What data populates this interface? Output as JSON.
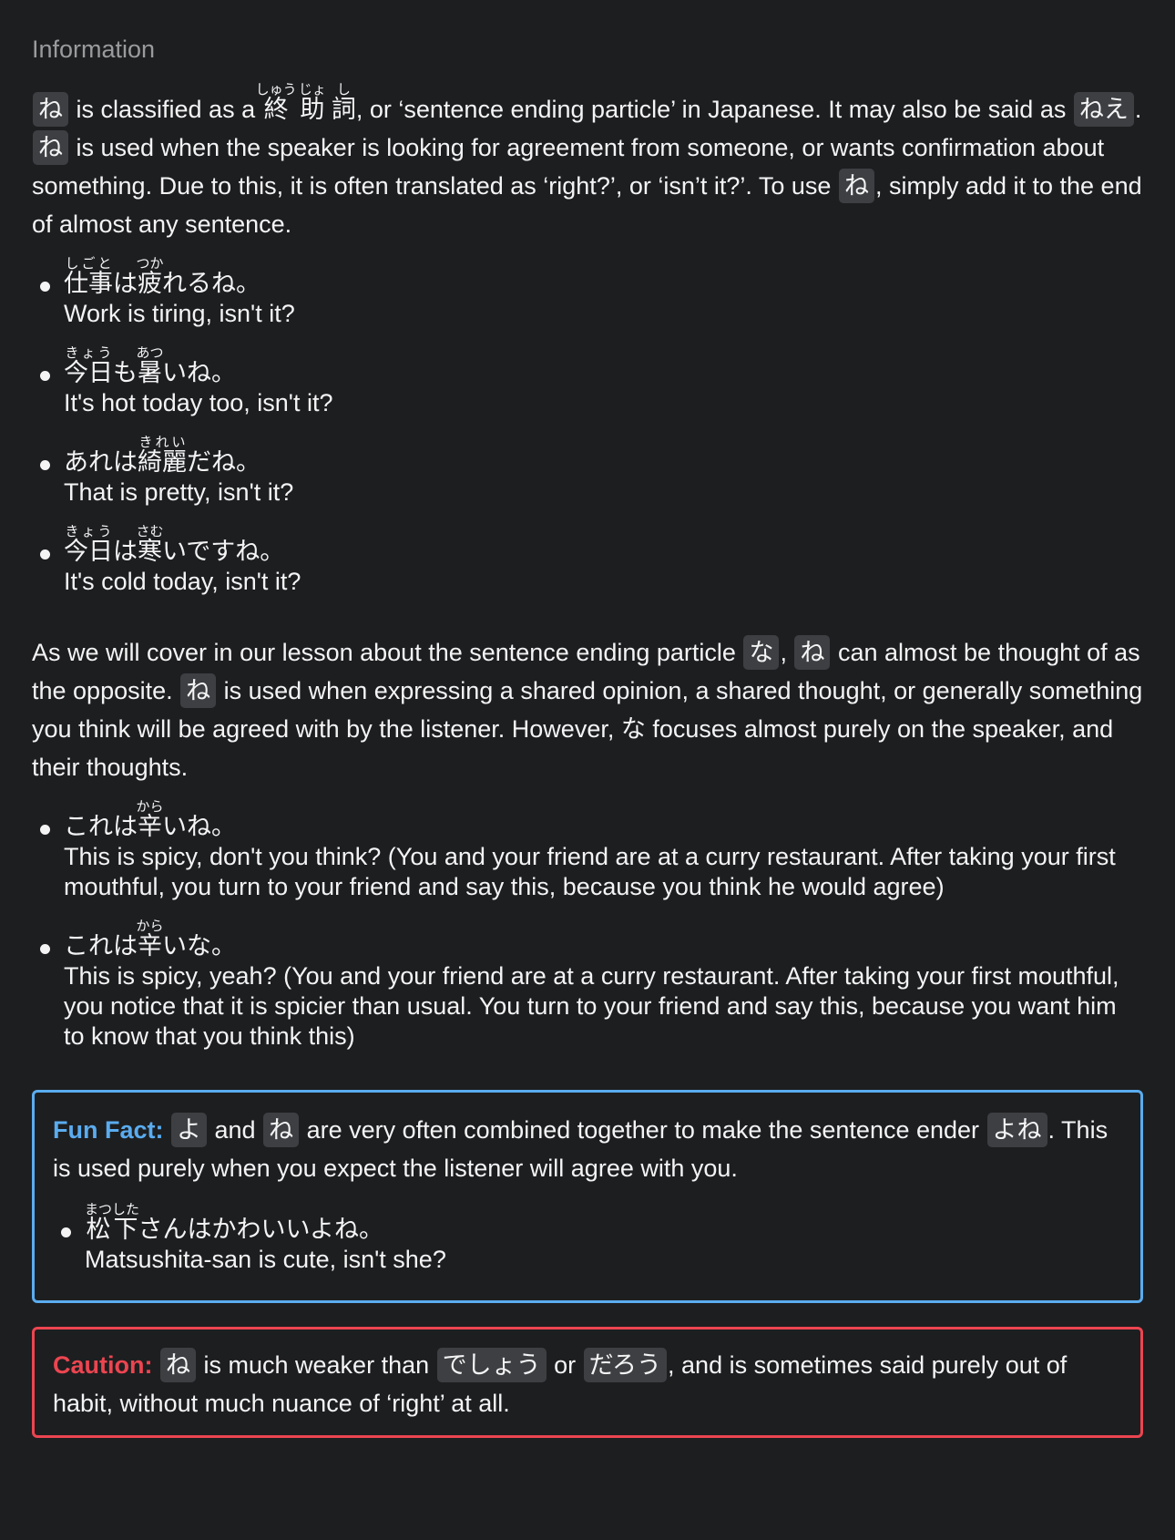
{
  "section_title": "Information",
  "intro": {
    "chip_ne": "ね",
    "t1": " is classified as a ",
    "kanji": [
      {
        "base": "終",
        "ruby": "しゅう"
      },
      {
        "base": "助",
        "ruby": "じょ"
      },
      {
        "base": "詞",
        "ruby": "し"
      }
    ],
    "t2": ", or ‘sentence ending particle’ in Japanese. It may also be said as ",
    "chip_nee": "ねえ",
    "t3": ". ",
    "t4": " is used when the speaker is looking for agreement from someone, or wants confirmation about something. Due to this, it is often translated as ‘right?’, or ‘isn’t it?’. To use ",
    "t5": ", simply add it to the end of almost any sentence."
  },
  "examples1": [
    {
      "segments": [
        {
          "base": "仕事",
          "ruby": "しごと"
        },
        {
          "text": "は"
        },
        {
          "base": "疲",
          "ruby": "つか"
        },
        {
          "text": "れるね。"
        }
      ],
      "english": "Work is tiring, isn't it?"
    },
    {
      "segments": [
        {
          "base": "今日",
          "ruby": "きょう"
        },
        {
          "text": "も"
        },
        {
          "base": "暑",
          "ruby": "あつ"
        },
        {
          "text": "いね。"
        }
      ],
      "english": "It's hot today too, isn't it?"
    },
    {
      "segments": [
        {
          "text": "あれは"
        },
        {
          "base": "綺麗",
          "ruby": "きれい"
        },
        {
          "text": "だね。"
        }
      ],
      "english": "That is pretty, isn't it?"
    },
    {
      "segments": [
        {
          "base": "今日",
          "ruby": "きょう"
        },
        {
          "text": "は"
        },
        {
          "base": "寒",
          "ruby": "さむ"
        },
        {
          "text": "いですね。"
        }
      ],
      "english": "It's cold today, isn't it?"
    }
  ],
  "comparison": {
    "t1": "As we will cover in our lesson about the sentence ending particle ",
    "chip_na": "な",
    "t2": ", ",
    "chip_ne": "ね",
    "t3": " can almost be thought of as the opposite. ",
    "t4": " is used when expressing a shared opinion, a shared thought, or generally something you think will be agreed with by the listener. However, な focuses almost purely on the speaker, and their thoughts."
  },
  "examples2": [
    {
      "segments": [
        {
          "text": "これは"
        },
        {
          "base": "辛",
          "ruby": "から"
        },
        {
          "text": "いね。"
        }
      ],
      "english": "This is spicy, don't you think? (You and your friend are at a curry restaurant. After taking your first mouthful, you turn to your friend and say this, because you think he would agree)"
    },
    {
      "segments": [
        {
          "text": "これは"
        },
        {
          "base": "辛",
          "ruby": "から"
        },
        {
          "text": "いな。"
        }
      ],
      "english": "This is spicy, yeah? (You and your friend are at a curry restaurant. After taking your first mouthful, you notice that it is spicier than usual. You turn to your friend and say this, because you want him to know that you think this)"
    }
  ],
  "fun_fact": {
    "label": "Fun Fact:",
    "chip_yo": "よ",
    "t1": " and ",
    "chip_ne": "ね",
    "t2": " are very often combined together to make the sentence ender ",
    "chip_yone": "よね",
    "t3": ". This is used purely when you expect the listener will agree with you.",
    "accent_color": "#5aacef",
    "example": {
      "segments": [
        {
          "base": "松",
          "ruby": "まつ"
        },
        {
          "base": "下",
          "ruby": "した"
        },
        {
          "text": "さんはかわいいよね。"
        }
      ],
      "english": "Matsushita-san is cute, isn't she?"
    }
  },
  "caution": {
    "label": "Caution:",
    "chip_ne": "ね",
    "t1": " is much weaker than ",
    "chip_deshou": "でしょう",
    "t2": " or ",
    "chip_darou": "だろう",
    "t3": ", and is sometimes said purely out of habit, without much nuance of ‘right’ at all.",
    "accent_color": "#ec4550"
  }
}
